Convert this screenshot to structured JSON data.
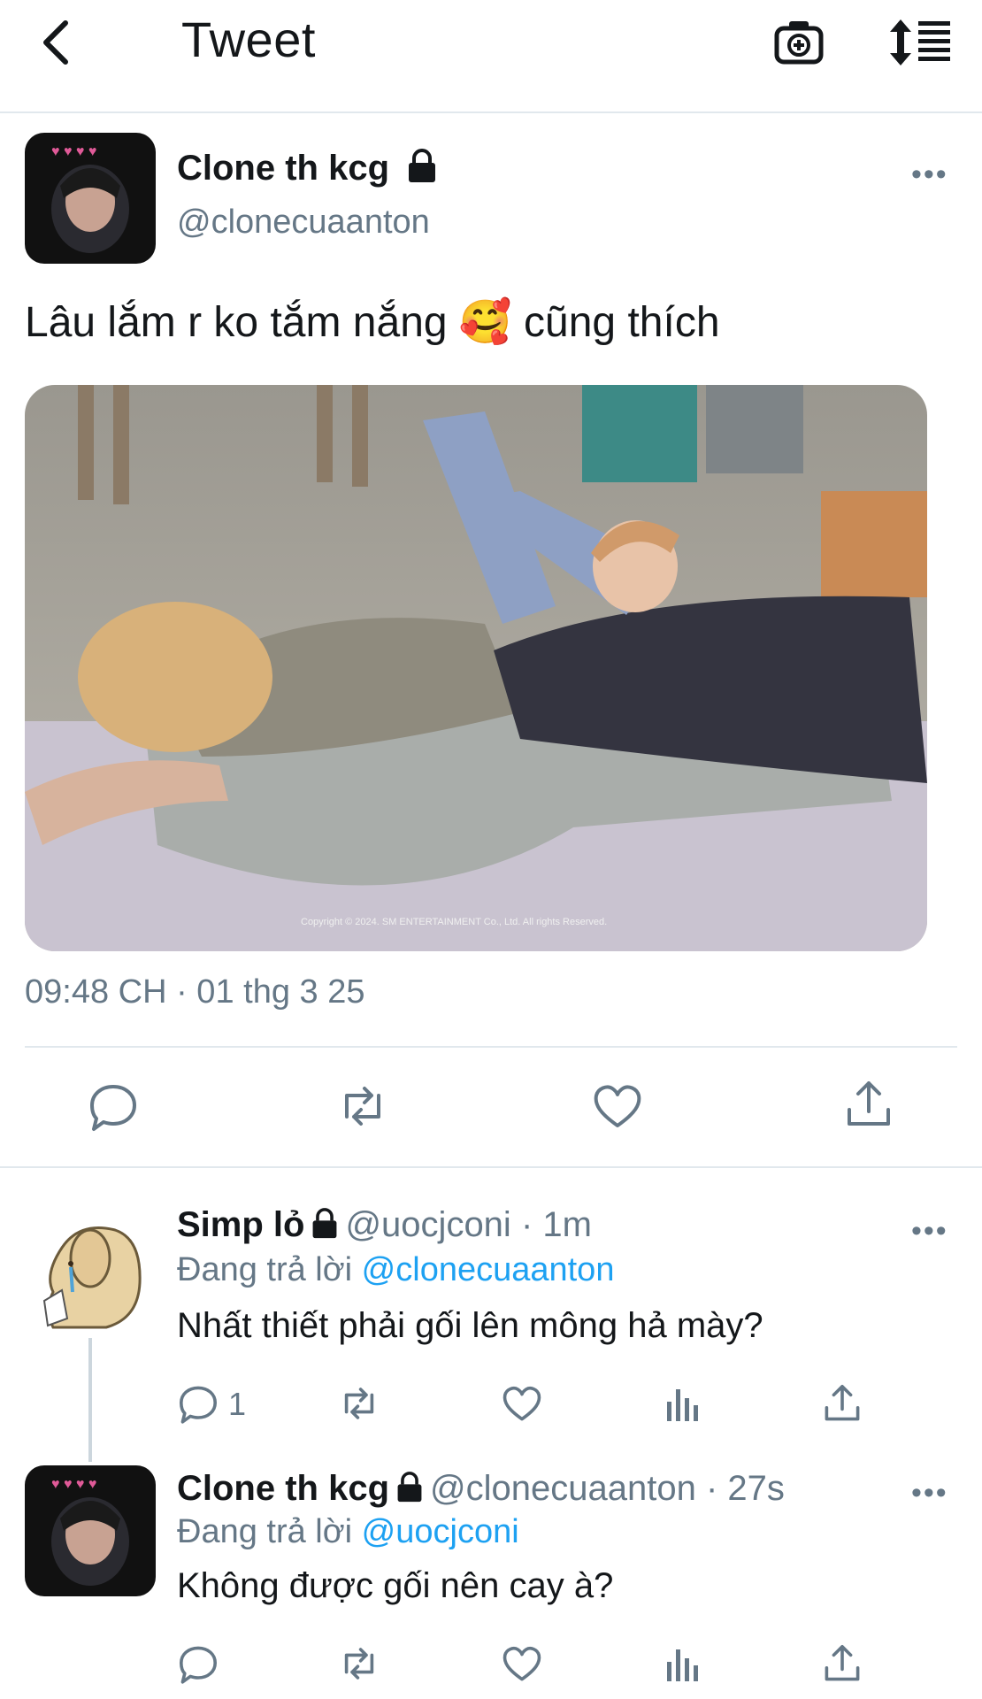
{
  "header": {
    "title": "Tweet",
    "icons": [
      "back-arrow-icon",
      "camera-add-icon",
      "sort-icon"
    ]
  },
  "main_tweet": {
    "name": "Clone th kcg",
    "handle": "@clonecuaanton",
    "more": "•••",
    "text": "Lâu lắm r ko tắm nắng 🥰 cũng thích",
    "photo_caption": "Copyright © 2024. SM ENTERTAINMENT Co., Ltd. All rights Reserved.",
    "timestamp": "09:48 CH · 01 thg 3 25"
  },
  "replies": [
    {
      "name": "Simp lỏ",
      "handle": "@uocjconi",
      "time": "· 1m",
      "reply_prefix": "Đang trả lời",
      "reply_to": "@clonecuaanton",
      "text": "Nhất thiết phải gối lên mông hả mày?",
      "reply_count": "1",
      "more": "•••"
    },
    {
      "name": "Clone th kcg",
      "handle": "@clonecuaanton",
      "time": "· 27s",
      "reply_prefix": "Đang trả lời",
      "reply_to": "@uocjconi",
      "text": "Không được gối nên cay à?",
      "more": "•••"
    }
  ],
  "colors": {
    "accent": "#1da1f2",
    "muted": "#657786",
    "divider": "#e1e8ed"
  }
}
